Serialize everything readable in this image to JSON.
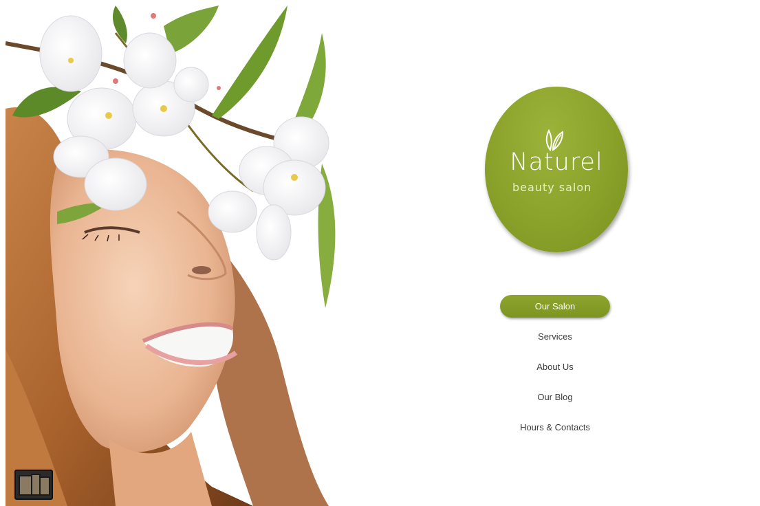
{
  "logo": {
    "name": "Naturel",
    "tagline": "beauty salon",
    "color": "#8aa22a"
  },
  "nav": {
    "items": [
      {
        "label": "Our Salon",
        "active": true
      },
      {
        "label": "Services",
        "active": false
      },
      {
        "label": "About Us",
        "active": false
      },
      {
        "label": "Our Blog",
        "active": false
      },
      {
        "label": "Hours & Contacts",
        "active": false
      }
    ]
  },
  "colors": {
    "accent": "#8aa22a",
    "nav_text": "#3b3b3b",
    "background": "#ffffff"
  }
}
